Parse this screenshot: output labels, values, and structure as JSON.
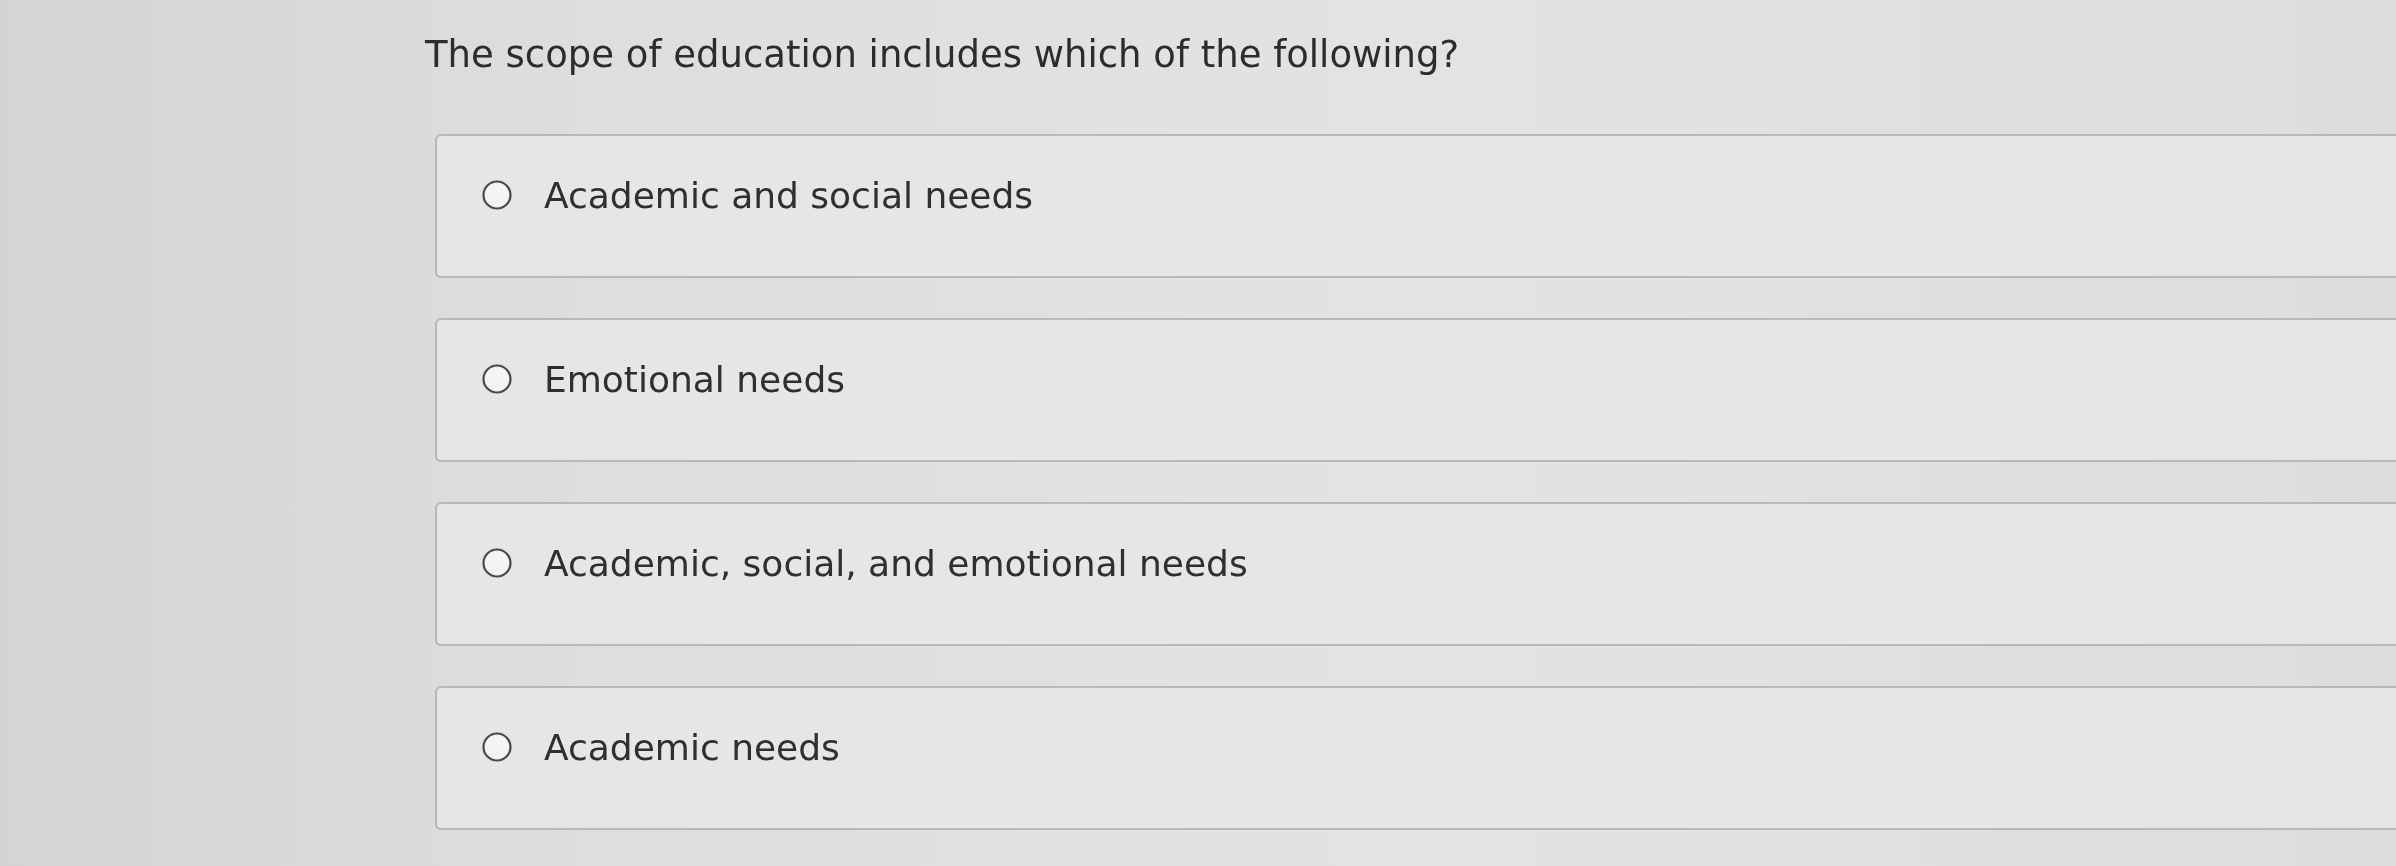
{
  "question": {
    "text": "The scope of education includes which of the following?"
  },
  "options": [
    {
      "label": "Academic and social needs",
      "selected": false
    },
    {
      "label": "Emotional needs",
      "selected": false
    },
    {
      "label": "Academic, social, and emotional needs",
      "selected": false
    },
    {
      "label": "Academic needs",
      "selected": false
    }
  ]
}
